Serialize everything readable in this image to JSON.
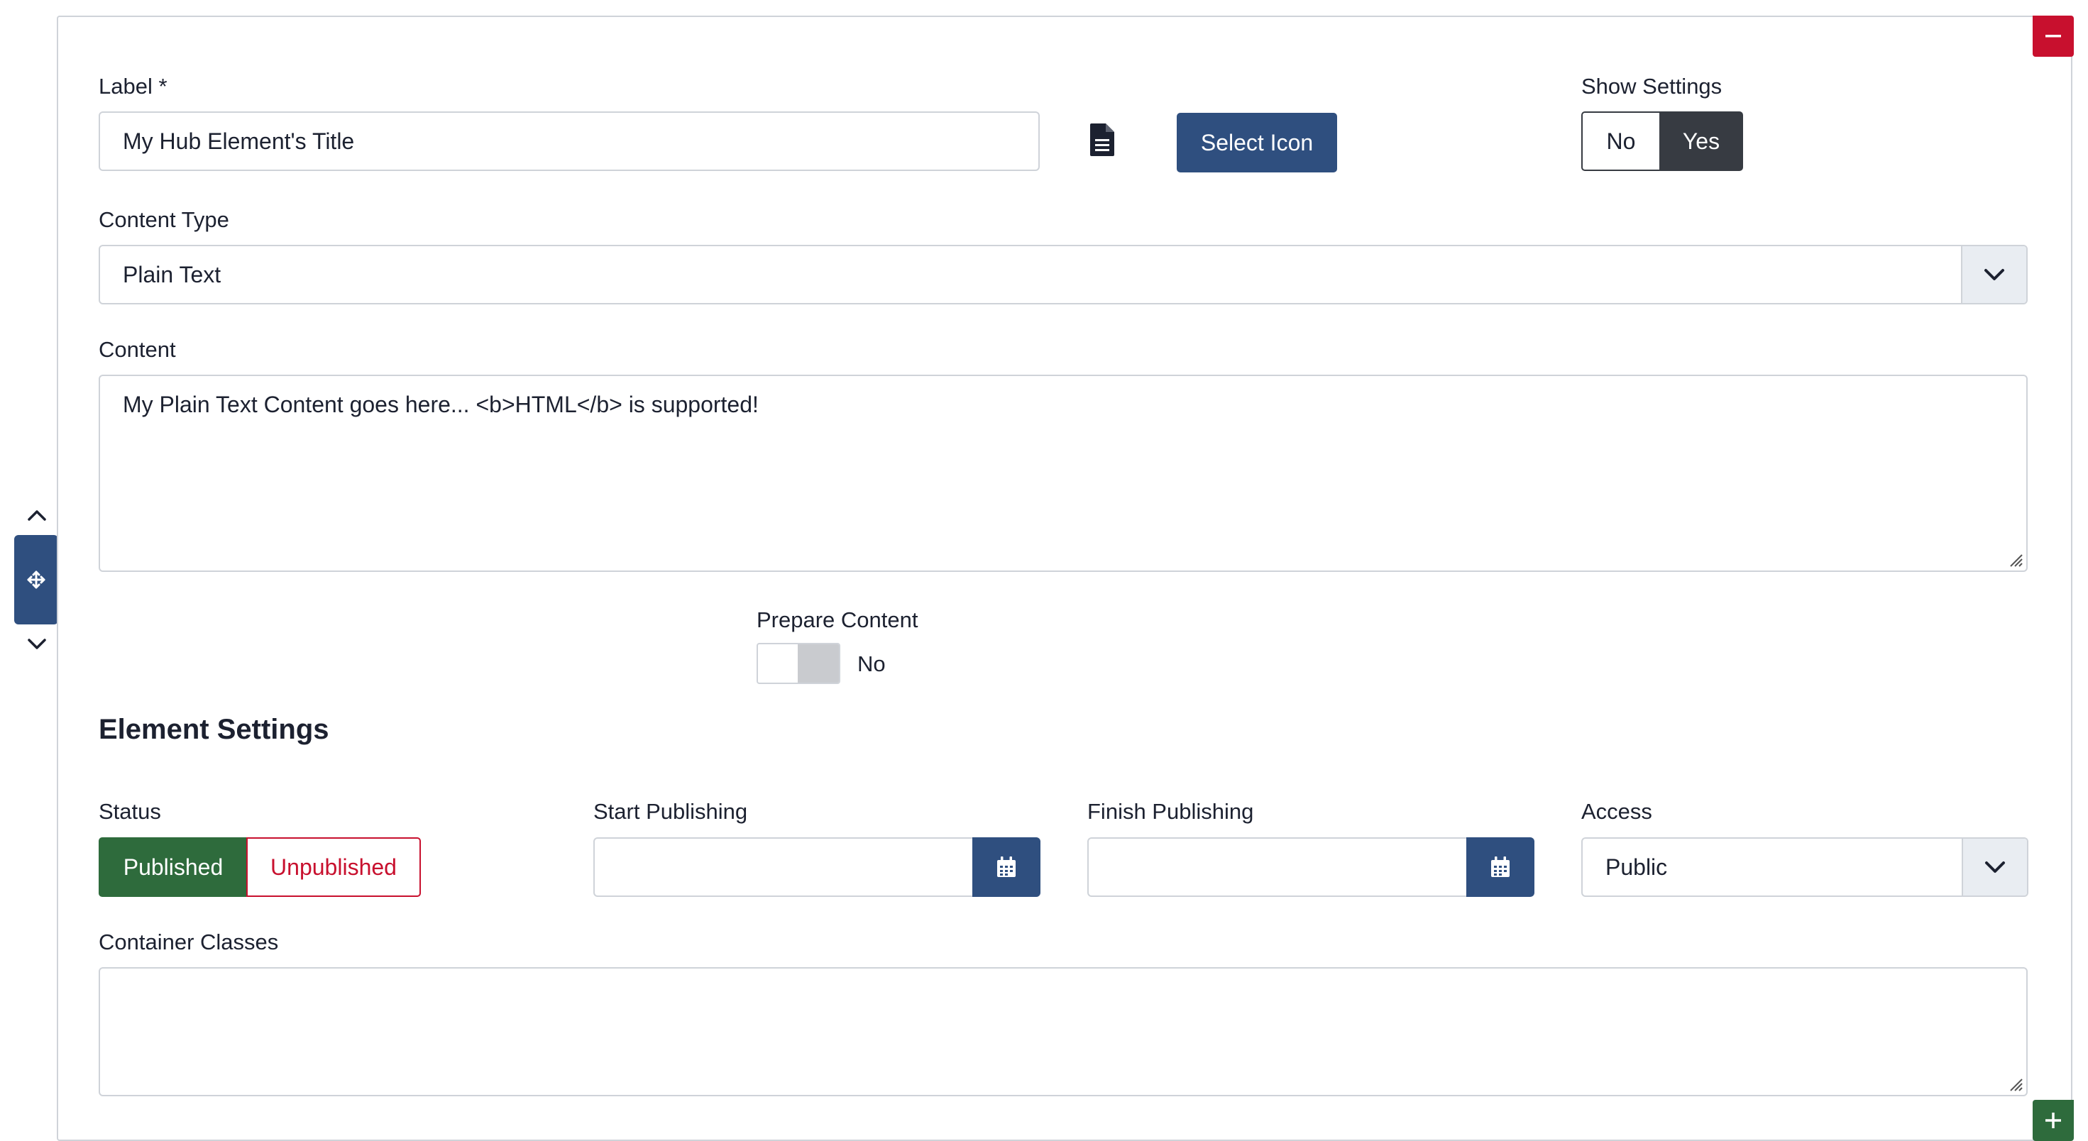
{
  "form": {
    "label_field": {
      "label": "Label *",
      "value": "My Hub Element's Title"
    },
    "icon": {
      "name": "file-text-icon",
      "button_label": "Select Icon"
    },
    "show_settings": {
      "label": "Show Settings",
      "options": [
        "No",
        "Yes"
      ],
      "selected": "Yes"
    },
    "content_type": {
      "label": "Content Type",
      "value": "Plain Text"
    },
    "content": {
      "label": "Content",
      "value": "My Plain Text Content goes here... <b>HTML</b> is supported!"
    },
    "prepare_content": {
      "label": "Prepare Content",
      "value_label": "No",
      "enabled": false
    }
  },
  "element_settings": {
    "title": "Element Settings",
    "status": {
      "label": "Status",
      "options": [
        "Published",
        "Unpublished"
      ],
      "selected": "Published"
    },
    "start_publishing": {
      "label": "Start Publishing",
      "value": ""
    },
    "finish_publishing": {
      "label": "Finish Publishing",
      "value": ""
    },
    "access": {
      "label": "Access",
      "value": "Public"
    },
    "container_classes": {
      "label": "Container Classes",
      "value": ""
    }
  },
  "controls": {
    "remove_icon": "minus-icon",
    "add_icon": "plus-icon",
    "move_icon": "move-icon",
    "up_icon": "chevron-up-icon",
    "down_icon": "chevron-down-icon"
  },
  "colors": {
    "primary": "#2f4f7f",
    "danger": "#c8102e",
    "success": "#2e6b3c",
    "dark": "#373b42"
  }
}
